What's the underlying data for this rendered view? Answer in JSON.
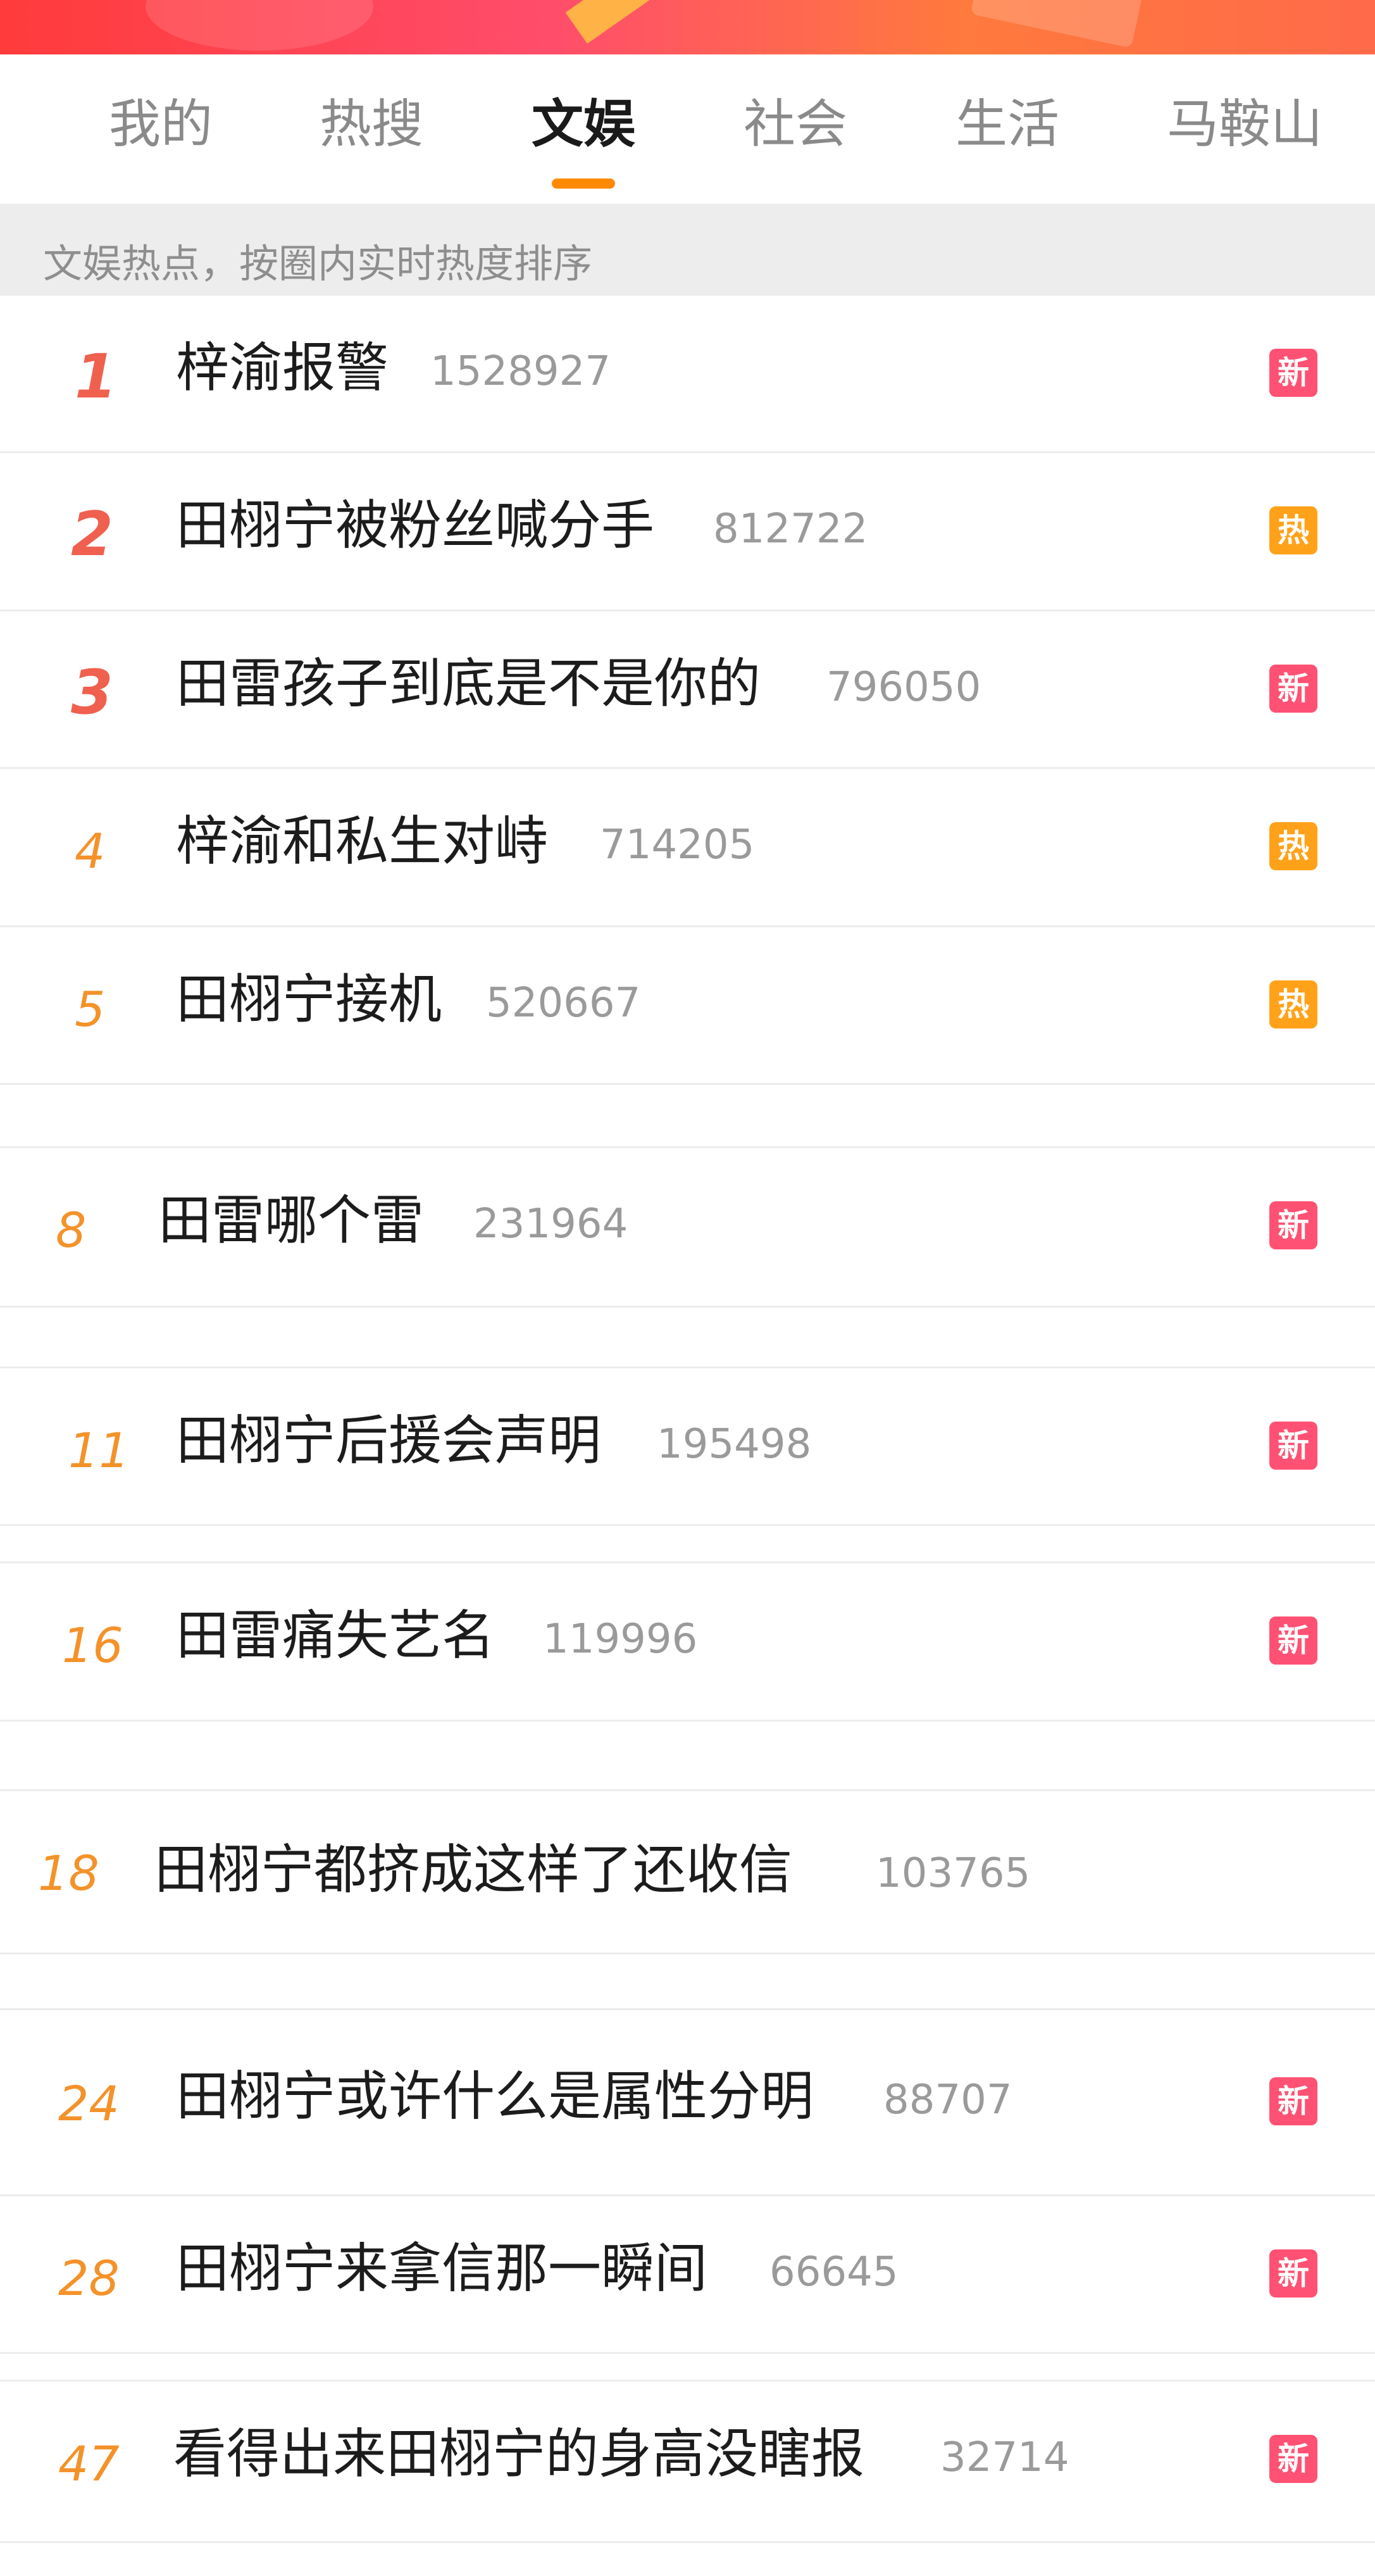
{
  "tabs": [
    "我的",
    "热搜",
    "文娱",
    "社会",
    "生活",
    "马鞍山"
  ],
  "active_tab": "文娱",
  "hint": "文娱热点，按圈内实时热度排序",
  "badge_labels": {
    "new": "新",
    "hot": "热"
  },
  "colors": {
    "accent": "#ff8a00",
    "rank_red": "#f0604f",
    "rank_orange": "#f4922a",
    "badge_new": "#ff5173",
    "badge_hot": "#ffa21a"
  },
  "rows": [
    {
      "rank": "1",
      "title": "梓渝报警",
      "count": "1528927",
      "badge": "新"
    },
    {
      "rank": "2",
      "title": "田栩宁被粉丝喊分手",
      "count": "812722",
      "badge": "热"
    },
    {
      "rank": "3",
      "title": "田雷孩子到底是不是你的",
      "count": "796050",
      "badge": "新"
    },
    {
      "rank": "4",
      "title": "梓渝和私生对峙",
      "count": "714205",
      "badge": "热"
    },
    {
      "rank": "5",
      "title": "田栩宁接机",
      "count": "520667",
      "badge": "热"
    },
    {
      "rank": "8",
      "title": "田雷哪个雷",
      "count": "231964",
      "badge": "新"
    },
    {
      "rank": "11",
      "title": "田栩宁后援会声明",
      "count": "195498",
      "badge": "新"
    },
    {
      "rank": "16",
      "title": "田雷痛失艺名",
      "count": "119996",
      "badge": "新"
    },
    {
      "rank": "18",
      "title": "田栩宁都挤成这样了还收信",
      "count": "103765",
      "badge": ""
    },
    {
      "rank": "24",
      "title": "田栩宁或许什么是属性分明",
      "count": "88707",
      "badge": "新"
    },
    {
      "rank": "28",
      "title": "田栩宁来拿信那一瞬间",
      "count": "66645",
      "badge": "新"
    },
    {
      "rank": "47",
      "title": "看得出来田栩宁的身高没瞎报",
      "count": "32714",
      "badge": "新"
    }
  ]
}
